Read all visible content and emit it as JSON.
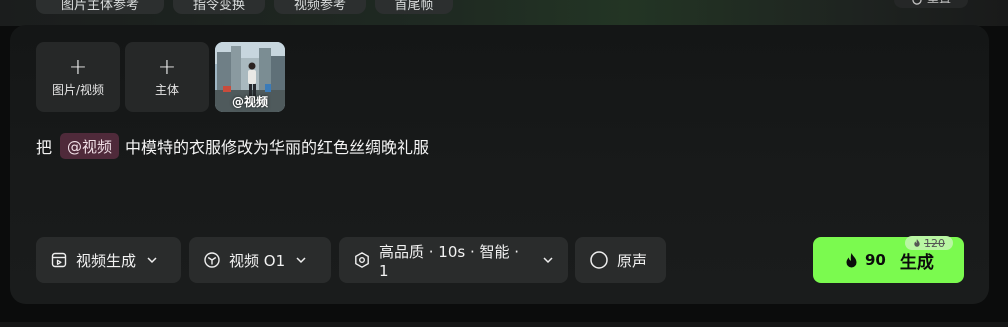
{
  "top_chips": {
    "chip1": "图片主体参考",
    "chip2": "指令变换",
    "chip3": "视频参考",
    "chip4": "首尾帧",
    "right_button": "重置"
  },
  "uploads": {
    "add_media_label": "图片/视频",
    "add_subject_label": "主体",
    "video_thumb_label": "@视频"
  },
  "prompt": {
    "prefix": "把",
    "mention": "@视频",
    "text": "中模特的衣服修改为华丽的红色丝绸晚礼服"
  },
  "controls": {
    "mode_label": "视频生成",
    "model_label": "视频 O1",
    "settings_label": "高品质 · 10s · 智能 · 1",
    "audio_label": "原声"
  },
  "generate": {
    "cost": "90",
    "label": "生成",
    "original_cost": "120"
  },
  "colors": {
    "accent": "#7bfa4f",
    "mention_bg": "#4f2a3a",
    "panel_bg": "#181a1a"
  }
}
